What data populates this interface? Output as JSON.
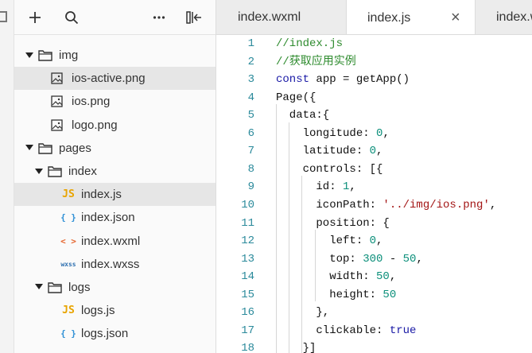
{
  "sidebar": {
    "toolbar": {
      "add_icon": "plus-icon",
      "search_icon": "search-icon",
      "more_icon": "ellipsis-icon",
      "collapse_icon": "collapse-panel-icon"
    },
    "tree": [
      {
        "label": "img",
        "type": "folder",
        "depth": 0,
        "expanded": true,
        "selected": false
      },
      {
        "label": "ios-active.png",
        "type": "image",
        "depth": 1,
        "selected": true
      },
      {
        "label": "ios.png",
        "type": "image",
        "depth": 1,
        "selected": false
      },
      {
        "label": "logo.png",
        "type": "image",
        "depth": 1,
        "selected": false
      },
      {
        "label": "pages",
        "type": "folder",
        "depth": 0,
        "expanded": true,
        "selected": false
      },
      {
        "label": "index",
        "type": "folder",
        "depth": 1,
        "expanded": true,
        "selected": false
      },
      {
        "label": "index.js",
        "type": "js",
        "depth": 2,
        "selected": true
      },
      {
        "label": "index.json",
        "type": "json",
        "depth": 2,
        "selected": false
      },
      {
        "label": "index.wxml",
        "type": "wxml",
        "depth": 2,
        "selected": false
      },
      {
        "label": "index.wxss",
        "type": "wxss",
        "depth": 2,
        "selected": false
      },
      {
        "label": "logs",
        "type": "folder",
        "depth": 1,
        "expanded": true,
        "selected": false
      },
      {
        "label": "logs.js",
        "type": "js",
        "depth": 2,
        "selected": false
      },
      {
        "label": "logs.json",
        "type": "json",
        "depth": 2,
        "selected": false
      }
    ],
    "badges": {
      "js": "JS",
      "json": "{ }",
      "wxml": "< >",
      "wxss": "wxss"
    }
  },
  "tabs": [
    {
      "label": "index.wxml",
      "active": false
    },
    {
      "label": "index.js",
      "active": true,
      "close": "×"
    },
    {
      "label": "index.w",
      "active": false
    }
  ],
  "editor": {
    "lines": [
      {
        "n": "1",
        "tokens": [
          [
            "c-comment",
            "//index.js"
          ]
        ]
      },
      {
        "n": "2",
        "tokens": [
          [
            "c-comment",
            "//获取应用实例"
          ]
        ]
      },
      {
        "n": "3",
        "tokens": [
          [
            "c-kw",
            "const"
          ],
          [
            "c-plain",
            " app = getApp()"
          ]
        ]
      },
      {
        "n": "4",
        "tokens": [
          [
            "c-plain",
            "Page({"
          ]
        ]
      },
      {
        "n": "5",
        "tokens": [
          [
            "c-plain",
            "  data:{"
          ]
        ]
      },
      {
        "n": "6",
        "tokens": [
          [
            "c-plain",
            "    longitude: "
          ],
          [
            "c-num",
            "0"
          ],
          [
            "c-plain",
            ","
          ]
        ]
      },
      {
        "n": "7",
        "tokens": [
          [
            "c-plain",
            "    latitude: "
          ],
          [
            "c-num",
            "0"
          ],
          [
            "c-plain",
            ","
          ]
        ]
      },
      {
        "n": "8",
        "tokens": [
          [
            "c-plain",
            "    controls: [{"
          ]
        ]
      },
      {
        "n": "9",
        "tokens": [
          [
            "c-plain",
            "      id: "
          ],
          [
            "c-num",
            "1"
          ],
          [
            "c-plain",
            ","
          ]
        ]
      },
      {
        "n": "10",
        "tokens": [
          [
            "c-plain",
            "      iconPath: "
          ],
          [
            "c-str",
            "'../img/ios.png'"
          ],
          [
            "c-plain",
            ","
          ]
        ]
      },
      {
        "n": "11",
        "tokens": [
          [
            "c-plain",
            "      position: {"
          ]
        ]
      },
      {
        "n": "12",
        "tokens": [
          [
            "c-plain",
            "        left: "
          ],
          [
            "c-num",
            "0"
          ],
          [
            "c-plain",
            ","
          ]
        ]
      },
      {
        "n": "13",
        "tokens": [
          [
            "c-plain",
            "        top: "
          ],
          [
            "c-num",
            "300"
          ],
          [
            "c-plain",
            " - "
          ],
          [
            "c-num",
            "50"
          ],
          [
            "c-plain",
            ","
          ]
        ]
      },
      {
        "n": "14",
        "tokens": [
          [
            "c-plain",
            "        width: "
          ],
          [
            "c-num",
            "50"
          ],
          [
            "c-plain",
            ","
          ]
        ]
      },
      {
        "n": "15",
        "tokens": [
          [
            "c-plain",
            "        height: "
          ],
          [
            "c-num",
            "50"
          ]
        ]
      },
      {
        "n": "16",
        "tokens": [
          [
            "c-plain",
            "      },"
          ]
        ]
      },
      {
        "n": "17",
        "tokens": [
          [
            "c-plain",
            "      clickable: "
          ],
          [
            "c-kw",
            "true"
          ]
        ]
      },
      {
        "n": "18",
        "tokens": [
          [
            "c-plain",
            "    }]"
          ]
        ]
      }
    ]
  },
  "colors": {
    "line_number": "#2b8a9b",
    "comment": "#2e8b2e",
    "keyword": "#1a1aa6",
    "number": "#0b8f7a",
    "string": "#a31515",
    "js_badge": "#e8a400",
    "json_badge": "#2d8fd5",
    "wxml_badge": "#e5652e",
    "wxss_badge": "#2d6fb0"
  }
}
